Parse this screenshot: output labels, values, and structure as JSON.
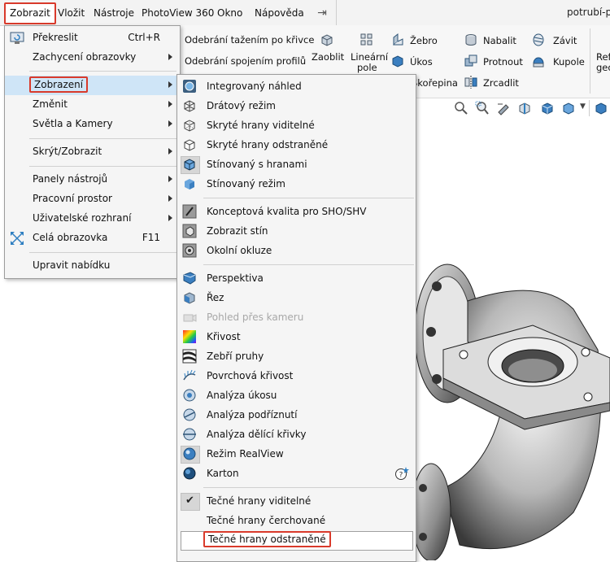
{
  "menubar": {
    "items": [
      "Zobrazit",
      "Vložit",
      "Nástroje",
      "PhotoView 360",
      "Okno",
      "Nápověda"
    ],
    "doc_title": "potrubí-p"
  },
  "ribbon": {
    "odebrani_tazenim": "Odebrání tažením po křivce",
    "odebrani_spojenim": "Odebrání spojením profilů",
    "zaoblit": "Zaoblit",
    "linearni_pole_1": "Lineární",
    "linearni_pole_2": "pole",
    "zebro": "Žebro",
    "ukos": "Úkos",
    "skorepina": "Skořepina",
    "nabalit": "Nabalit",
    "protnout": "Protnout",
    "zrcadlit": "Zrcadlit",
    "zavit": "Závit",
    "kupole": "Kupole",
    "ref_1": "Ref",
    "ref_2": "geo"
  },
  "menu1": {
    "items": [
      {
        "label": "Překreslit",
        "shortcut": "Ctrl+R",
        "arrow": false
      },
      {
        "label": "Zachycení obrazovky",
        "shortcut": "",
        "arrow": true
      },
      {
        "label": "Zobrazení",
        "shortcut": "",
        "arrow": true
      },
      {
        "label": "Změnit",
        "shortcut": "",
        "arrow": true
      },
      {
        "label": "Světla a Kamery",
        "shortcut": "",
        "arrow": true
      },
      {
        "label": "Skrýt/Zobrazit",
        "shortcut": "",
        "arrow": true
      },
      {
        "label": "Panely nástrojů",
        "shortcut": "",
        "arrow": true
      },
      {
        "label": "Pracovní prostor",
        "shortcut": "",
        "arrow": true
      },
      {
        "label": "Uživatelské rozhraní",
        "shortcut": "",
        "arrow": true
      },
      {
        "label": "Celá obrazovka",
        "shortcut": "F11",
        "arrow": false
      },
      {
        "label": "Upravit nabídku",
        "shortcut": "",
        "arrow": false
      }
    ]
  },
  "menu2": {
    "items": [
      {
        "label": "Integrovaný náhled",
        "icon": "integrated-preview-icon"
      },
      {
        "label": "Drátový režim",
        "icon": "wireframe-icon"
      },
      {
        "label": "Skryté hrany viditelné",
        "icon": "hidden-lines-visible-icon"
      },
      {
        "label": "Skryté hrany odstraněné",
        "icon": "hidden-lines-removed-icon"
      },
      {
        "label": "Stínovaný s hranami",
        "icon": "shaded-with-edges-icon"
      },
      {
        "label": "Stínovaný režim",
        "icon": "shaded-icon"
      },
      {
        "label": "Konceptová kvalita pro SHO/SHV",
        "icon": "draft-quality-icon"
      },
      {
        "label": "Zobrazit stín",
        "icon": "shadows-icon"
      },
      {
        "label": "Okolní okluze",
        "icon": "ambient-occlusion-icon"
      },
      {
        "label": "Perspektiva",
        "icon": "perspective-icon"
      },
      {
        "label": "Řez",
        "icon": "section-view-icon"
      },
      {
        "label": "Pohled přes kameru",
        "icon": "camera-view-icon"
      },
      {
        "label": "Křivost",
        "icon": "curvature-icon"
      },
      {
        "label": "Zebří pruhy",
        "icon": "zebra-stripes-icon"
      },
      {
        "label": "Povrchová křivost",
        "icon": "curvature-combs-icon"
      },
      {
        "label": "Analýza úkosu",
        "icon": "draft-analysis-icon"
      },
      {
        "label": "Analýza podříznutí",
        "icon": "undercut-analysis-icon"
      },
      {
        "label": "Analýza dělící křivky",
        "icon": "parting-line-analysis-icon"
      },
      {
        "label": "Režim RealView",
        "icon": "realview-icon"
      },
      {
        "label": "Karton",
        "icon": "cartoon-icon"
      },
      {
        "label": "Tečné hrany viditelné",
        "icon": "check-icon"
      },
      {
        "label": "Tečné hrany čerchované",
        "icon": ""
      },
      {
        "label": "Tečné hrany odstraněné",
        "icon": ""
      }
    ]
  },
  "colors": {
    "highlight_border": "#d93a2b",
    "menu_highlight": "#cfe5f7",
    "accent_blue": "#2f7fc1"
  }
}
